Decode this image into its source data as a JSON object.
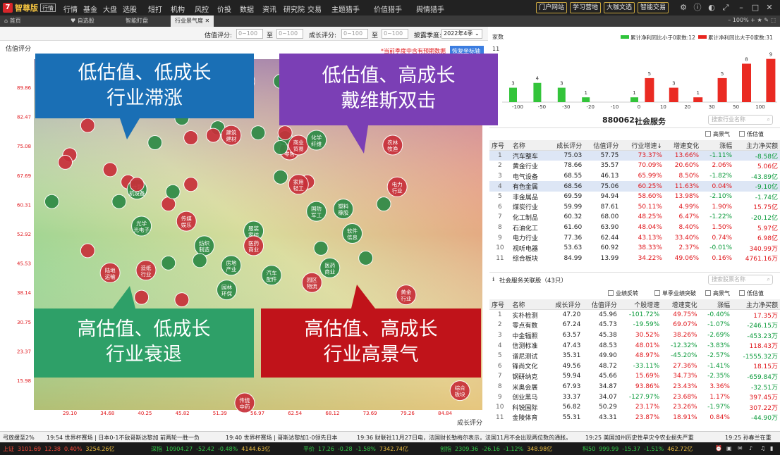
{
  "app": {
    "logo_mark": "7",
    "name": "智尊版",
    "mode": "行情"
  },
  "menu": [
    "行情",
    "基金",
    "大盘",
    "选股",
    "短打",
    "机构",
    "风控",
    "价投",
    "数据",
    "资讯",
    "研究院",
    "交易",
    "主题猎手",
    "价值猎手",
    "舆情猎手"
  ],
  "menu_dots": [
    3,
    12,
    13,
    14
  ],
  "top_buttons": [
    "门户网站",
    "学习营地",
    "大咖文选",
    "智能交易"
  ],
  "tabs": [
    "首页",
    "自选股",
    "智能盯盘",
    "行业景气度"
  ],
  "zoom_text": "100%",
  "filters": {
    "valuation_label": "估值评分:",
    "growth_label": "成长评分:",
    "range_placeholder": "0~100",
    "to": "至",
    "season_label": "披露季度:",
    "season_value": "2022年4季"
  },
  "chart": {
    "ylabel": "估值评分",
    "xlabel": "成长评分",
    "note": "*当前季度中含有预期数据",
    "reset_button": "恢复坐标轴",
    "x_ticks": [
      "29.10",
      "34.68",
      "40.25",
      "45.82",
      "51.39",
      "56.97",
      "62.54",
      "68.12",
      "73.69",
      "79.26",
      "84.84"
    ],
    "y_ticks": [
      "89.86",
      "82.47",
      "75.08",
      "67.69",
      "60.31",
      "52.92",
      "45.53",
      "38.14",
      "30.75",
      "23.37",
      "15.98"
    ],
    "bubbles": [
      {
        "x": 0.05,
        "y": 0.13,
        "c": "g"
      },
      {
        "x": 0.12,
        "y": 0.27,
        "c": "r"
      },
      {
        "x": 0.08,
        "y": 0.39,
        "c": "r"
      },
      {
        "x": 0.27,
        "y": 0.34,
        "c": "g"
      },
      {
        "x": 0.33,
        "y": 0.24,
        "c": "g"
      },
      {
        "x": 0.31,
        "y": 0.15,
        "c": "r"
      },
      {
        "x": 0.47,
        "y": 0.09,
        "c": "r",
        "t": "中药"
      },
      {
        "x": 0.55,
        "y": 0.09,
        "c": "g"
      },
      {
        "x": 0.57,
        "y": 0.37,
        "c": "r",
        "t": "商业零售"
      },
      {
        "x": 0.56,
        "y": 0.32,
        "c": "g"
      },
      {
        "x": 0.56,
        "y": 0.3,
        "c": "r"
      },
      {
        "x": 0.5,
        "y": 0.3,
        "c": "g"
      },
      {
        "x": 0.41,
        "y": 0.28,
        "c": "g"
      },
      {
        "x": 0.4,
        "y": 0.31,
        "c": "r"
      },
      {
        "x": 0.35,
        "y": 0.32,
        "c": "r"
      },
      {
        "x": 0.44,
        "y": 0.31,
        "c": "r",
        "t": "建筑建材"
      },
      {
        "x": 0.59,
        "y": 0.35,
        "c": "r",
        "t": "商业贸易"
      },
      {
        "x": 0.55,
        "y": 0.36,
        "c": "g"
      },
      {
        "x": 0.61,
        "y": 0.5,
        "c": "r"
      },
      {
        "x": 0.55,
        "y": 0.48,
        "c": "g"
      },
      {
        "x": 0.63,
        "y": 0.33,
        "c": "g",
        "t": "化学纤维"
      },
      {
        "x": 0.8,
        "y": 0.35,
        "c": "r",
        "t": "农林牧渔"
      },
      {
        "x": 0.21,
        "y": 0.5,
        "c": "r"
      },
      {
        "x": 0.17,
        "y": 0.45,
        "c": "r"
      },
      {
        "x": 0.04,
        "y": 0.58,
        "c": "g"
      },
      {
        "x": 0.07,
        "y": 0.42,
        "c": "r"
      },
      {
        "x": 0.19,
        "y": 0.58,
        "c": "g"
      },
      {
        "x": 0.35,
        "y": 0.51,
        "c": "r"
      },
      {
        "x": 0.23,
        "y": 0.53,
        "c": "g",
        "t": "计算机设备"
      },
      {
        "x": 0.3,
        "y": 0.59,
        "c": "r"
      },
      {
        "x": 0.31,
        "y": 0.54,
        "c": "g"
      },
      {
        "x": 0.23,
        "y": 0.51,
        "c": "r"
      },
      {
        "x": 0.63,
        "y": 0.62,
        "c": "g",
        "t": "国防军工"
      },
      {
        "x": 0.69,
        "y": 0.61,
        "c": "g",
        "t": "塑料橡胶"
      },
      {
        "x": 0.59,
        "y": 0.51,
        "c": "r",
        "t": "家用轻工"
      },
      {
        "x": 0.78,
        "y": 0.59,
        "c": "g"
      },
      {
        "x": 0.81,
        "y": 0.52,
        "c": "r",
        "t": "电力行业"
      },
      {
        "x": 0.24,
        "y": 0.68,
        "c": "g",
        "t": "光学光电子"
      },
      {
        "x": 0.34,
        "y": 0.66,
        "c": "r",
        "t": "传媒娱乐"
      },
      {
        "x": 0.38,
        "y": 0.76,
        "c": "g",
        "t": "纺织制造"
      },
      {
        "x": 0.37,
        "y": 0.82,
        "c": "g"
      },
      {
        "x": 0.49,
        "y": 0.7,
        "c": "g",
        "t": "服装家纺"
      },
      {
        "x": 0.49,
        "y": 0.76,
        "c": "r",
        "t": "医药商业"
      },
      {
        "x": 0.71,
        "y": 0.71,
        "c": "g",
        "t": "软件信息"
      },
      {
        "x": 0.64,
        "y": 0.77,
        "c": "g"
      },
      {
        "x": 0.74,
        "y": 0.81,
        "c": "g"
      },
      {
        "x": 0.66,
        "y": 0.85,
        "c": "g",
        "t": "医药商业"
      },
      {
        "x": 0.44,
        "y": 0.84,
        "c": "g",
        "t": "房地产业"
      },
      {
        "x": 0.53,
        "y": 0.88,
        "c": "g",
        "t": "汽车配件"
      },
      {
        "x": 0.17,
        "y": 0.87,
        "c": "r",
        "t": "陆地运输"
      },
      {
        "x": 0.25,
        "y": 0.86,
        "c": "r",
        "t": "造纸行业"
      },
      {
        "x": 0.3,
        "y": 0.83,
        "c": "g"
      },
      {
        "x": 0.12,
        "y": 0.78,
        "c": "r"
      },
      {
        "x": 0.43,
        "y": 0.94,
        "c": "g",
        "t": "园林环保"
      },
      {
        "x": 0.62,
        "y": 0.91,
        "c": "r",
        "t": "园区物流"
      },
      {
        "x": 0.83,
        "y": 0.96,
        "c": "r",
        "t": "黄金行业"
      },
      {
        "x": 0.47,
        "y": 1.4,
        "c": "r",
        "t": "传统中药"
      },
      {
        "x": 0.95,
        "y": 1.35,
        "c": "r",
        "t": "综合板块"
      },
      {
        "x": 0.33,
        "y": 0.98,
        "c": "r"
      },
      {
        "x": 0.24,
        "y": 0.97,
        "c": "r"
      }
    ]
  },
  "callouts": [
    {
      "l1": "低估值、低成长",
      "l2": "行业滞涨"
    },
    {
      "l1": "低估值、高成长",
      "l2": "戴维斯双击"
    },
    {
      "l1": "高估值、低成长",
      "l2": "行业衰退"
    },
    {
      "l1": "高估值、高成长",
      "l2": "行业高景气"
    }
  ],
  "dist": {
    "title": "家数",
    "legend_down": "累计净利同比小于0家数:12",
    "legend_up": "累计净利同比大于0家数:31",
    "ymax_label": "11",
    "bins": [
      "-100",
      "-50",
      "-30",
      "-20",
      "-10",
      "0",
      "10",
      "20",
      "30",
      "50",
      "100"
    ],
    "green": [
      3,
      4,
      3,
      1,
      0,
      1,
      0,
      0,
      0,
      0,
      0
    ],
    "red": [
      0,
      0,
      0,
      0,
      0,
      0,
      5,
      3,
      1,
      5,
      8,
      9
    ],
    "green_labels": [
      "3",
      "4",
      "3",
      "1",
      "",
      "1",
      "",
      "",
      "",
      "",
      ""
    ],
    "red_labels": [
      "",
      "",
      "",
      "",
      "",
      "",
      "5",
      "3",
      "1",
      "5",
      "8",
      "9"
    ]
  },
  "sector": {
    "code": "880062",
    "name": "社会服务",
    "search_placeholder": "搜索行业名称"
  },
  "sector_checks": [
    "高景气",
    "低估值"
  ],
  "sector_table": {
    "headers": [
      "序号",
      "名称",
      "成长评分",
      "估值评分",
      "行业增速↓",
      "增速变化",
      "涨幅",
      "主力净买额"
    ],
    "rows": [
      [
        "1",
        "汽车整车",
        "75.03",
        "57.75",
        "73.37%",
        "13.66%",
        "-1.11%",
        "-8.58亿"
      ],
      [
        "2",
        "黄金行业",
        "78.66",
        "35.57",
        "70.09%",
        "20.60%",
        "2.06%",
        "5.06亿"
      ],
      [
        "3",
        "电气设备",
        "68.55",
        "46.13",
        "65.99%",
        "8.50%",
        "-1.82%",
        "-43.89亿"
      ],
      [
        "4",
        "有色金属",
        "68.56",
        "75.06",
        "60.25%",
        "11.63%",
        "0.04%",
        "-9.10亿"
      ],
      [
        "5",
        "非金属品",
        "69.59",
        "94.94",
        "58.60%",
        "13.98%",
        "-2.10%",
        "-1.74亿"
      ],
      [
        "6",
        "煤炭行业",
        "59.99",
        "87.61",
        "50.11%",
        "4.99%",
        "1.90%",
        "15.75亿"
      ],
      [
        "7",
        "化工制品",
        "60.32",
        "68.00",
        "48.25%",
        "6.47%",
        "-1.22%",
        "-20.12亿"
      ],
      [
        "8",
        "石油化工",
        "61.60",
        "63.90",
        "48.04%",
        "8.40%",
        "1.50%",
        "5.97亿"
      ],
      [
        "9",
        "电力行业",
        "77.36",
        "62.44",
        "43.13%",
        "33.40%",
        "0.74%",
        "6.98亿"
      ],
      [
        "10",
        "视听电器",
        "53.63",
        "60.92",
        "38.33%",
        "2.37%",
        "-0.01%",
        "340.99万"
      ],
      [
        "11",
        "综合板块",
        "84.99",
        "13.99",
        "34.22%",
        "49.06%",
        "0.16%",
        "4761.16万"
      ]
    ]
  },
  "stocks": {
    "title": "社会服务关联股（43只）",
    "search_placeholder": "搜索股票名称"
  },
  "stock_checks": [
    "业绩反转",
    "单季业绩突破",
    "高景气",
    "低估值"
  ],
  "stock_table": {
    "headers": [
      "序号",
      "名称",
      "成长评分",
      "估值评分",
      "个股增速",
      "增速变化",
      "涨幅",
      "主力净买额"
    ],
    "rows": [
      [
        "1",
        "实朴检测",
        "47.20",
        "45.96",
        "-101.72%",
        "49.75%",
        "-0.40%",
        "17.35万"
      ],
      [
        "2",
        "零点有数",
        "67.24",
        "45.73",
        "-19.59%",
        "69.07%",
        "-1.07%",
        "-246.15万"
      ],
      [
        "3",
        "中金辐照",
        "63.57",
        "45.38",
        "30.52%",
        "38.26%",
        "-2.69%",
        "-453.23万"
      ],
      [
        "4",
        "信测标准",
        "47.43",
        "48.53",
        "48.01%",
        "-12.32%",
        "-3.83%",
        "118.43万"
      ],
      [
        "5",
        "谱尼测试",
        "35.31",
        "49.90",
        "48.97%",
        "-45.20%",
        "-2.57%",
        "-1555.32万"
      ],
      [
        "6",
        "锋尚文化",
        "49.56",
        "48.72",
        "-33.11%",
        "27.36%",
        "-1.41%",
        "18.15万"
      ],
      [
        "7",
        "钢研纳克",
        "59.94",
        "45.66",
        "15.69%",
        "34.73%",
        "-2.35%",
        "-659.84万"
      ],
      [
        "8",
        "米奥会展",
        "67.93",
        "34.87",
        "93.86%",
        "23.43%",
        "3.36%",
        "-32.51万"
      ],
      [
        "9",
        "创业黑马",
        "33.37",
        "34.07",
        "-127.97%",
        "23.68%",
        "1.17%",
        "397.45万"
      ],
      [
        "10",
        "科锐国际",
        "56.82",
        "50.29",
        "23.17%",
        "23.26%",
        "-1.97%",
        "307.22万"
      ],
      [
        "11",
        "金陵体育",
        "55.31",
        "43.31",
        "23.87%",
        "18.91%",
        "0.84%",
        "-44.90万"
      ]
    ]
  },
  "ticker": [
    "弓放缓至2%",
    "19:54 世界杯赛场 | 日本0-1不敌哥斯达黎加 前两轮一胜一负",
    "19:40 世界杯赛场 | 哥斯达黎加1-0领先日本",
    "19:36 财联社11月27日电，法国财长勒梅尔表示，法国11月不会出现两位数的通胀。",
    "19:25 美国加州历史性旱灾令农业损失严重",
    "19:25 孙春兰在重"
  ],
  "indices": [
    {
      "name": "上证",
      "price": "3101.69",
      "chg": "12.38",
      "pct": "0.40%",
      "amt": "3254.26亿",
      "up": true
    },
    {
      "name": "深指",
      "price": "10904.27",
      "chg": "-52.42",
      "pct": "-0.48%",
      "amt": "4144.63亿",
      "up": false
    },
    {
      "name": "平价",
      "price": "17.26",
      "chg": "-0.28",
      "pct": "-1.58%",
      "amt": "7342.74亿",
      "up": false
    },
    {
      "name": "创指",
      "price": "2309.36",
      "chg": "-26.16",
      "pct": "-1.12%",
      "amt": "348.98亿",
      "up": false
    },
    {
      "name": "科50",
      "price": "999.99",
      "chg": "-15.37",
      "pct": "-1.51%",
      "amt": "462.72亿",
      "up": false
    }
  ]
}
